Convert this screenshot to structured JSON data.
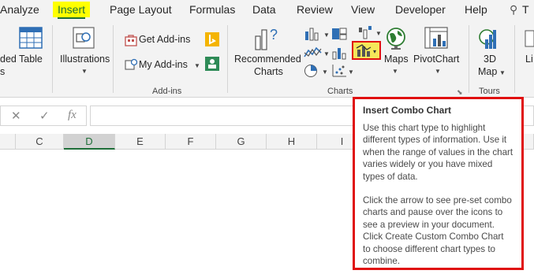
{
  "tabs": [
    {
      "label": "Analyze",
      "active": false
    },
    {
      "label": "Insert",
      "active": true
    },
    {
      "label": "Page Layout",
      "active": false
    },
    {
      "label": "Formulas",
      "active": false
    },
    {
      "label": "Data",
      "active": false
    },
    {
      "label": "Review",
      "active": false
    },
    {
      "label": "View",
      "active": false
    },
    {
      "label": "Developer",
      "active": false
    },
    {
      "label": "Help",
      "active": false
    },
    {
      "label": "T",
      "active": false
    }
  ],
  "ribbon": {
    "partial_left_top": "ded",
    "partial_left_bottom": "s",
    "table_label": "Table",
    "illustrations_label": "Illustrations",
    "get_addins_label": "Get Add-ins",
    "my_addins_label": "My Add-ins",
    "addins_group": "Add-ins",
    "recommended_charts_line1": "Recommended",
    "recommended_charts_line2": "Charts",
    "maps_label": "Maps",
    "pivotchart_label": "PivotChart",
    "charts_group": "Charts",
    "map3d_line1": "3D",
    "map3d_line2": "Map",
    "tours_group": "Tours",
    "partial_right": "Li"
  },
  "formula_bar": {
    "cancel": "✕",
    "enter": "✓",
    "fx": "fx"
  },
  "columns": [
    "C",
    "D",
    "E",
    "F",
    "G",
    "H",
    "I"
  ],
  "selected_column": "D",
  "tooltip": {
    "title": "Insert Combo Chart",
    "para1": "Use this chart type to highlight different types of information. Use it when the range of values in the chart varies widely or you have mixed types of data.",
    "para2": "Click the arrow to see pre-set combo charts and pause over the icons to see a preview in your document. Click Create Custom Combo Chart to choose different chart types to combine."
  },
  "colors": {
    "accent_green": "#1e6e38",
    "highlight_yellow": "#ffff00",
    "annotation_red": "#e01010"
  }
}
